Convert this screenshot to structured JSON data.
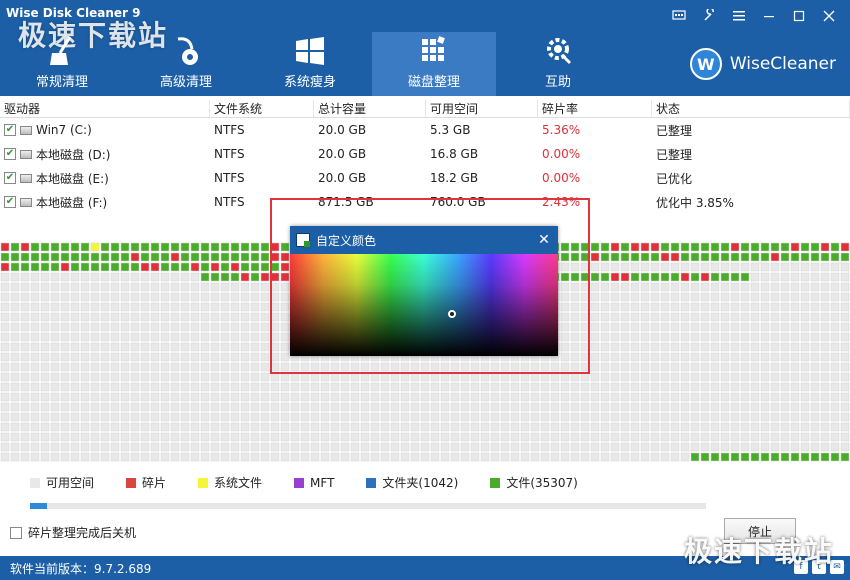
{
  "window": {
    "title": "Wise Disk Cleaner 9",
    "watermark": "极速下载站"
  },
  "nav": {
    "items": [
      {
        "label": "常规清理",
        "icon": "broom-icon",
        "active": false
      },
      {
        "label": "高级清理",
        "icon": "vacuum-icon",
        "active": false
      },
      {
        "label": "系统瘦身",
        "icon": "windows-icon",
        "active": false
      },
      {
        "label": "磁盘整理",
        "icon": "defrag-icon",
        "active": true
      },
      {
        "label": "互助",
        "icon": "gear-wrench-icon",
        "active": false
      }
    ]
  },
  "brand": {
    "logo_letter": "W",
    "name": "WiseCleaner"
  },
  "table": {
    "headers": [
      "驱动器",
      "文件系统",
      "总计容量",
      "可用空间",
      "碎片率",
      "状态"
    ],
    "rows": [
      {
        "drive": "Win7 (C:)",
        "fs": "NTFS",
        "total": "20.0 GB",
        "free": "5.3 GB",
        "frag": "5.36%",
        "status": "已整理",
        "checked": true
      },
      {
        "drive": "本地磁盘 (D:)",
        "fs": "NTFS",
        "total": "20.0 GB",
        "free": "16.8 GB",
        "frag": "0.00%",
        "status": "已整理",
        "checked": true
      },
      {
        "drive": "本地磁盘 (E:)",
        "fs": "NTFS",
        "total": "20.0 GB",
        "free": "18.2 GB",
        "frag": "0.00%",
        "status": "已优化",
        "checked": true
      },
      {
        "drive": "本地磁盘 (F:)",
        "fs": "NTFS",
        "total": "871.5 GB",
        "free": "760.0 GB",
        "frag": "2.43%",
        "status": "优化中 3.85%",
        "checked": true
      }
    ]
  },
  "dialog": {
    "title": "自定义颜色",
    "close_glyph": "✕"
  },
  "legend": [
    {
      "label": "可用空间",
      "color": "#e8e8e8"
    },
    {
      "label": "碎片",
      "color": "#d9453f"
    },
    {
      "label": "系统文件",
      "color": "#f5f53a"
    },
    {
      "label": "MFT",
      "color": "#9b3fd0"
    },
    {
      "label": "文件夹(1042)",
      "color": "#2f6fc0"
    },
    {
      "label": "文件(35307)",
      "color": "#4aac2a"
    }
  ],
  "colors": {
    "header_bg": "#1d5fa6",
    "fragment_red": "#e0303a",
    "file_green": "#4aac2a"
  },
  "progress": {
    "fraction": 0.025
  },
  "options": {
    "shutdown_label": "碎片整理完成后关机"
  },
  "buttons": {
    "stop": "停止"
  },
  "status": {
    "version": "软件当前版本：9.7.2.689"
  }
}
